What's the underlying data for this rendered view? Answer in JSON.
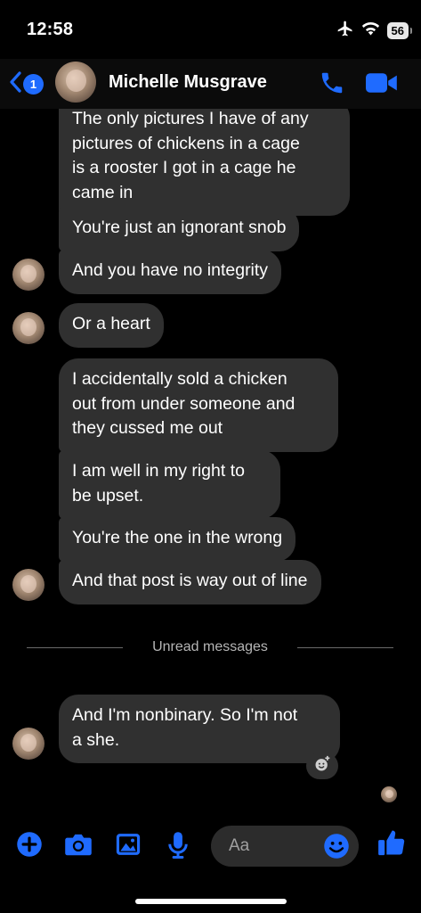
{
  "status_bar": {
    "time": "12:58",
    "battery": "56"
  },
  "header": {
    "back_badge": "1",
    "contact_name": "Michelle Musgrave"
  },
  "messages": [
    {
      "text": "The only pictures I have of any\npictures of chickens in a cage\nis a rooster I got in a cage he\ncame in"
    },
    {
      "text": "You're just an ignorant snob"
    },
    {
      "text": "And you have no integrity"
    },
    {
      "text": "Or a heart"
    },
    {
      "text": "I accidentally sold a chicken\nout from under someone and\nthey cussed me out"
    },
    {
      "text": "I am well in my right to\nbe upset."
    },
    {
      "text": "You're the one in the wrong"
    },
    {
      "text": "And that post is way out of line"
    },
    {
      "text": "And I'm nonbinary. So I'm not\na she."
    }
  ],
  "divider": {
    "label": "Unread messages"
  },
  "composer": {
    "placeholder": "Aa"
  },
  "colors": {
    "accent": "#1f6bff",
    "bubble": "#303030",
    "background": "#000000"
  },
  "icons": [
    "airplane-icon",
    "wifi-icon",
    "back-chevron-icon",
    "phone-icon",
    "video-icon",
    "add-reaction-icon",
    "plus-icon",
    "camera-icon",
    "gallery-icon",
    "mic-icon",
    "emoji-icon",
    "thumbs-up-icon"
  ]
}
